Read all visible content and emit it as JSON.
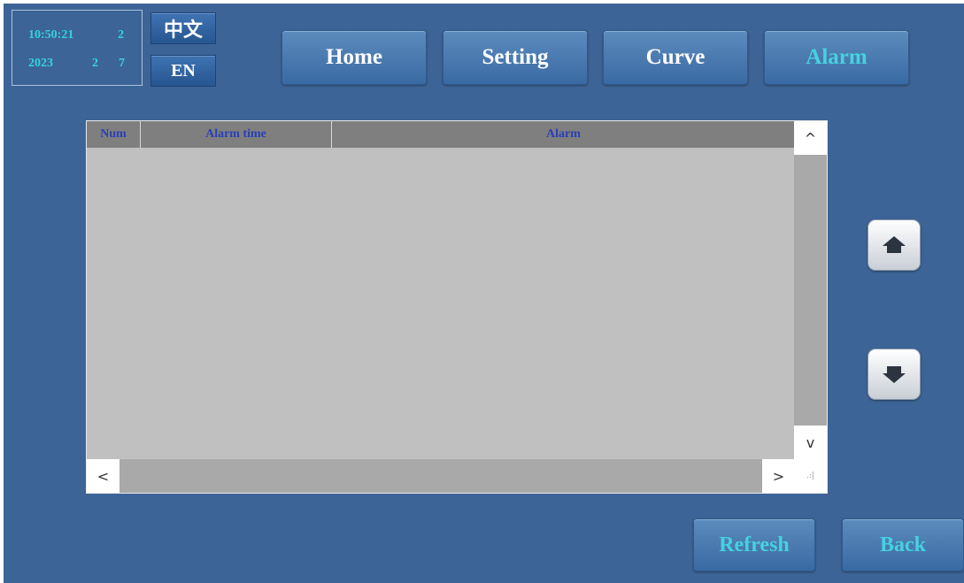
{
  "clock": {
    "time": "10:50:21",
    "weekday": "2",
    "year": "2023",
    "month": "2",
    "day": "7"
  },
  "language": {
    "chinese_label": "中文",
    "english_label": "EN"
  },
  "nav": {
    "home": "Home",
    "setting": "Setting",
    "curve": "Curve",
    "alarm": "Alarm",
    "active": "alarm"
  },
  "alarm_table": {
    "columns": [
      "Num",
      "Alarm time",
      "Alarm"
    ],
    "rows": []
  },
  "scrollbar": {
    "up_glyph": "^",
    "down_glyph": "v",
    "left_glyph": "<",
    "right_glyph": ">"
  },
  "actions": {
    "refresh": "Refresh",
    "back": "Back"
  },
  "colors": {
    "background": "#3d6496",
    "active_text": "#47d1e0",
    "clock_text": "#35d3dc",
    "header_text": "#2a3fb8"
  }
}
